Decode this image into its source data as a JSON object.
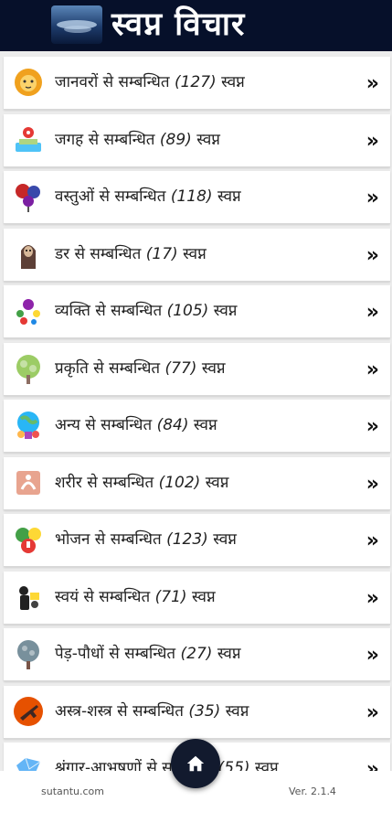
{
  "header": {
    "title": "स्वप्न विचार",
    "logo_icon": "night-sky-logo"
  },
  "rows": [
    {
      "label": "जानवरों से सम्बन्धित",
      "count": "(127)",
      "suffix": "स्वप्न",
      "icon": "lion-icon",
      "color": "#f0a11e"
    },
    {
      "label": "जगह से सम्बन्धित",
      "count": "(89)",
      "suffix": "स्वप्न",
      "icon": "map-pin-icon",
      "color": "#e53935"
    },
    {
      "label": "वस्तुओं से सम्बन्धित",
      "count": "(118)",
      "suffix": "स्वप्न",
      "icon": "objects-icon",
      "color": "#c62828"
    },
    {
      "label": "डर से सम्बन्धित",
      "count": "(17)",
      "suffix": "स्वप्न",
      "icon": "ghost-icon",
      "color": "#5d4037"
    },
    {
      "label": "व्यक्ति से सम्बन्धित",
      "count": "(105)",
      "suffix": "स्वप्न",
      "icon": "person-icon",
      "color": "#8e24aa"
    },
    {
      "label": "प्रकृति से सम्बन्धित",
      "count": "(77)",
      "suffix": "स्वप्न",
      "icon": "tree-icon",
      "color": "#9ccc65"
    },
    {
      "label": "अन्य से सम्बन्धित",
      "count": "(84)",
      "suffix": "स्वप्न",
      "icon": "globe-people-icon",
      "color": "#29b6f6"
    },
    {
      "label": "शरीर से सम्बन्धित",
      "count": "(102)",
      "suffix": "स्वप्न",
      "icon": "body-icon",
      "color": "#e8a48f"
    },
    {
      "label": "भोजन से सम्बन्धित",
      "count": "(123)",
      "suffix": "स्वप्न",
      "icon": "food-icon",
      "color": "#43a047"
    },
    {
      "label": "स्वयं से सम्बन्धित",
      "count": "(71)",
      "suffix": "स्वप्न",
      "icon": "self-icon",
      "color": "#212121"
    },
    {
      "label": "पेड़-पौधों से सम्बन्धित",
      "count": "(27)",
      "suffix": "स्वप्न",
      "icon": "plant-icon",
      "color": "#78909c"
    },
    {
      "label": "अस्त्र-शस्त्र से सम्बन्धित",
      "count": "(35)",
      "suffix": "स्वप्न",
      "icon": "weapon-icon",
      "color": "#e65100"
    },
    {
      "label": "श्रृंगार-आभषणों से सम्बन्धित",
      "count": "(55)",
      "suffix": "स्वप्न",
      "icon": "jewel-icon",
      "color": "#64b5f6"
    }
  ],
  "chevron": "»",
  "footer": {
    "site": "sutantu.com",
    "version": "Ver. 2.1.4",
    "home_icon": "home-icon"
  }
}
